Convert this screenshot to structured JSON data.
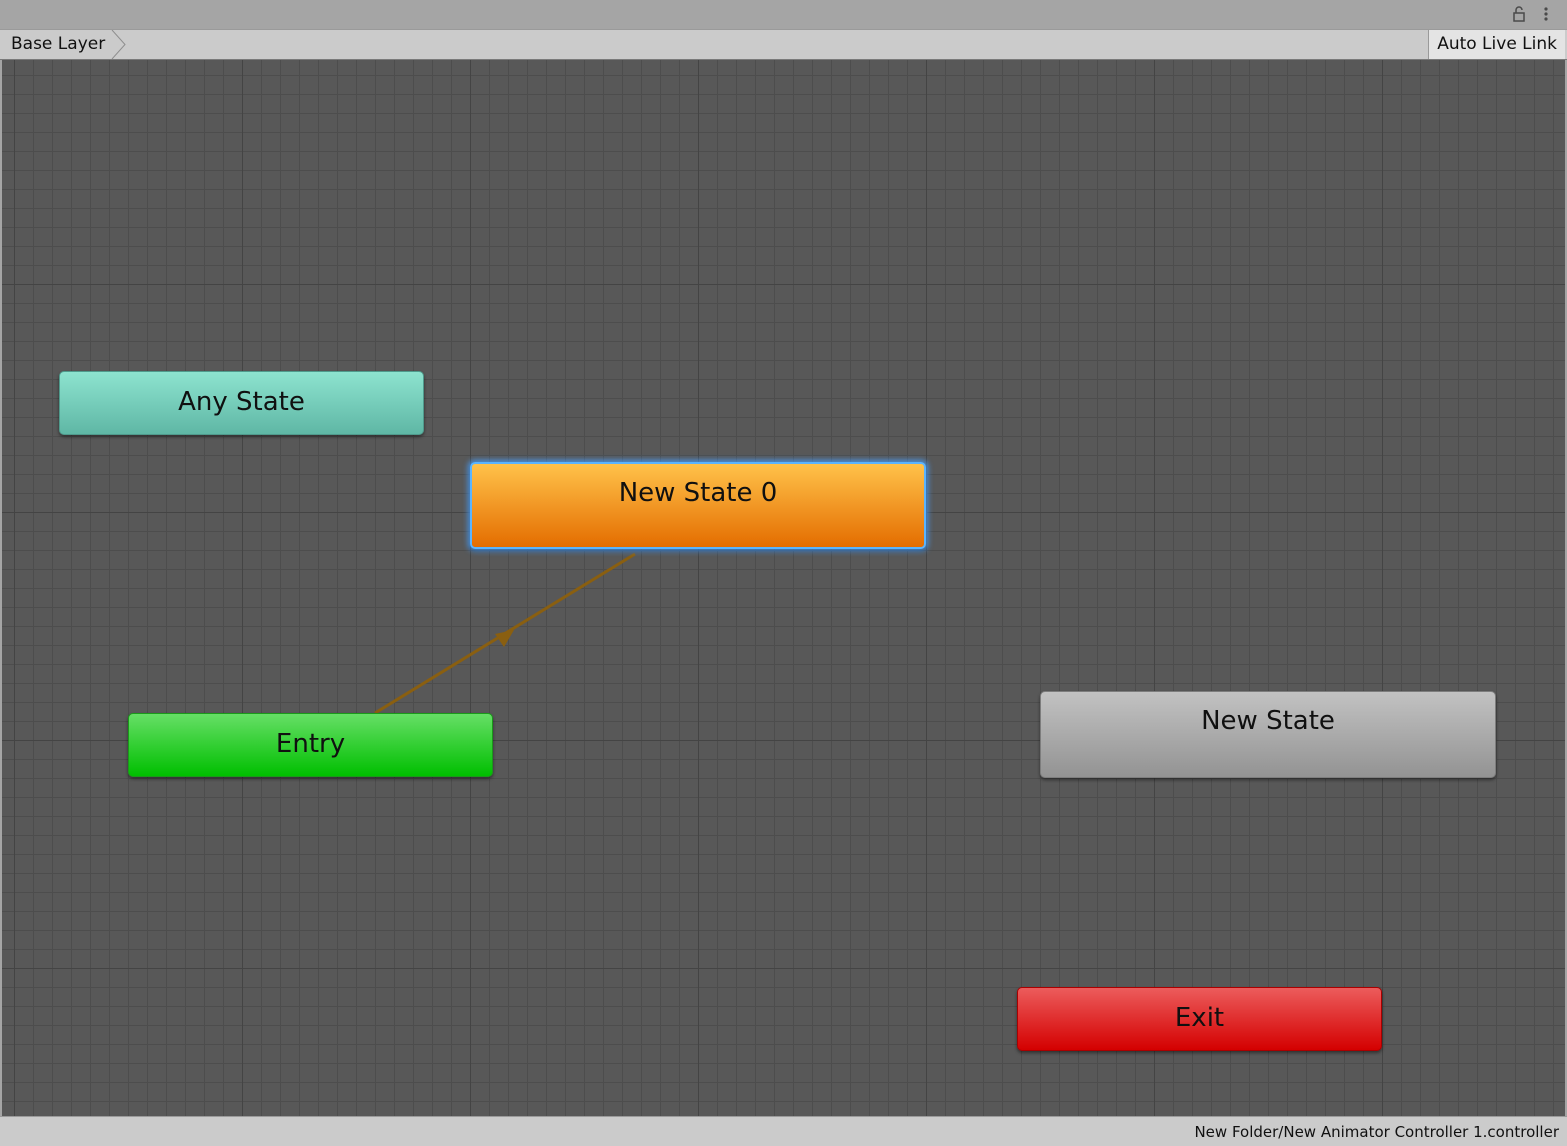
{
  "toolbar": {
    "lock_icon": "lock-icon",
    "menu_icon": "kebab-menu-icon"
  },
  "breadcrumb": {
    "layer": "Base Layer",
    "auto_live_link": "Auto Live Link"
  },
  "graph": {
    "nodes": {
      "any_state": {
        "label": "Any State",
        "color": "#7dd6c3"
      },
      "new_state_0": {
        "label": "New State 0",
        "color": "#f29a1c",
        "selected": true,
        "default": true
      },
      "entry": {
        "label": "Entry",
        "color": "#22cc22"
      },
      "new_state": {
        "label": "New State",
        "color": "#adadad"
      },
      "exit": {
        "label": "Exit",
        "color": "#e02020"
      }
    },
    "transitions": [
      {
        "from": "Entry",
        "to": "New State 0",
        "color": "#8a5f10"
      }
    ]
  },
  "status": {
    "path": "New Folder/New Animator Controller 1.controller"
  }
}
